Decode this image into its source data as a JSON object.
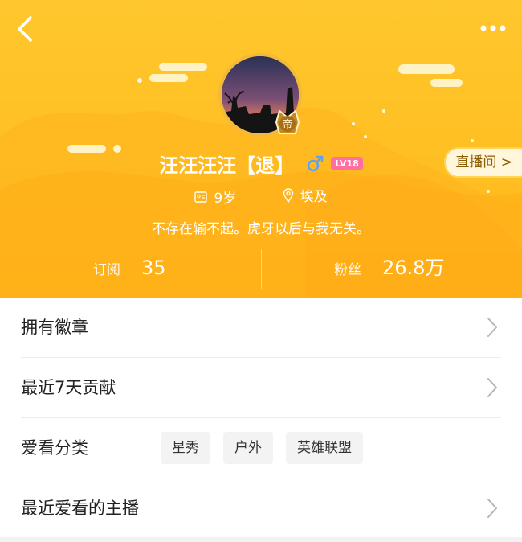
{
  "header": {
    "profile": {
      "name": "汪汪汪汪【退】",
      "gender_icon": "male-icon",
      "level_badge": "LV18",
      "age": "9岁",
      "location": "埃及",
      "signature": "不存在输不起。虎牙以后与我无关。",
      "emperor_badge": "帝"
    },
    "live_room_button": "直播间 >",
    "stats": {
      "subscribe_label": "订阅",
      "subscribe_value": "35",
      "fans_label": "粉丝",
      "fans_value": "26.8万"
    },
    "colors": {
      "background": "#ffc12a",
      "level_badge": "#ff6f9f"
    }
  },
  "list": {
    "badges_label": "拥有徽章",
    "contribution_label": "最近7天贡献",
    "categories_label": "爱看分类",
    "categories": [
      "星秀",
      "户外",
      "英雄联盟"
    ],
    "favorite_streamers_label": "最近爱看的主播"
  }
}
